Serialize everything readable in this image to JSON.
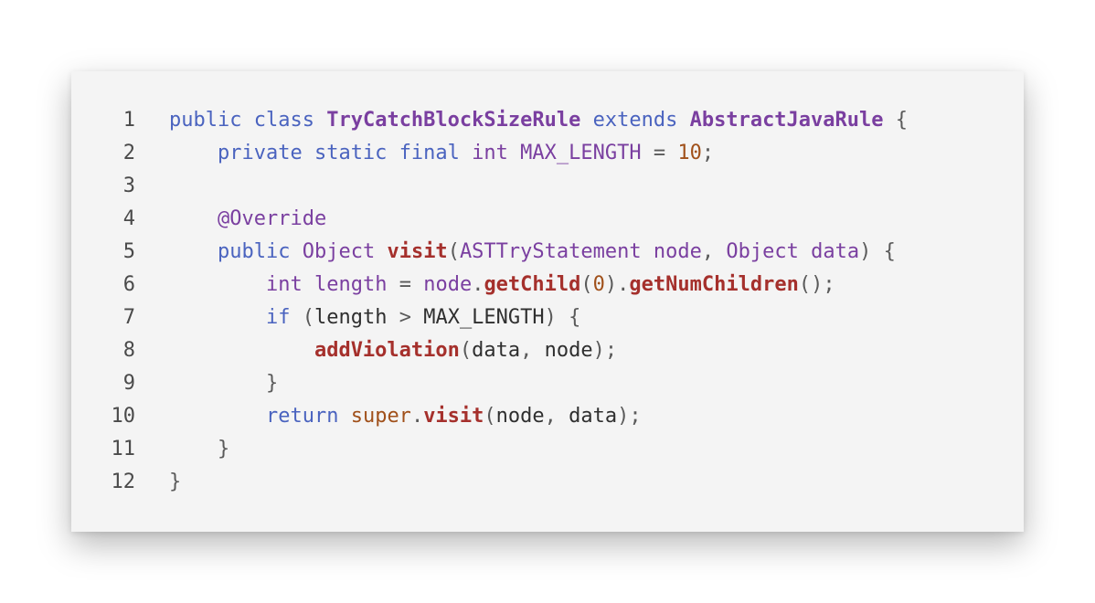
{
  "code": {
    "lines": [
      {
        "number": "1",
        "tokens": [
          {
            "text": "public",
            "kind": "keyword"
          },
          {
            "text": " ",
            "kind": "space"
          },
          {
            "text": "class",
            "kind": "keyword"
          },
          {
            "text": " ",
            "kind": "space"
          },
          {
            "text": "TryCatchBlockSizeRule",
            "kind": "class"
          },
          {
            "text": " ",
            "kind": "space"
          },
          {
            "text": "extends",
            "kind": "keyword"
          },
          {
            "text": " ",
            "kind": "space"
          },
          {
            "text": "AbstractJavaRule",
            "kind": "class"
          },
          {
            "text": " {",
            "kind": "punct"
          }
        ]
      },
      {
        "number": "2",
        "tokens": [
          {
            "text": "    ",
            "kind": "space"
          },
          {
            "text": "private",
            "kind": "keyword"
          },
          {
            "text": " ",
            "kind": "space"
          },
          {
            "text": "static",
            "kind": "keyword"
          },
          {
            "text": " ",
            "kind": "space"
          },
          {
            "text": "final",
            "kind": "keyword"
          },
          {
            "text": " ",
            "kind": "space"
          },
          {
            "text": "int",
            "kind": "type"
          },
          {
            "text": " ",
            "kind": "space"
          },
          {
            "text": "MAX_LENGTH",
            "kind": "type"
          },
          {
            "text": " = ",
            "kind": "punct"
          },
          {
            "text": "10",
            "kind": "number"
          },
          {
            "text": ";",
            "kind": "punct"
          }
        ]
      },
      {
        "number": "3",
        "tokens": []
      },
      {
        "number": "4",
        "tokens": [
          {
            "text": "    ",
            "kind": "space"
          },
          {
            "text": "@Override",
            "kind": "annotation"
          }
        ]
      },
      {
        "number": "5",
        "tokens": [
          {
            "text": "    ",
            "kind": "space"
          },
          {
            "text": "public",
            "kind": "keyword"
          },
          {
            "text": " ",
            "kind": "space"
          },
          {
            "text": "Object",
            "kind": "type"
          },
          {
            "text": " ",
            "kind": "space"
          },
          {
            "text": "visit",
            "kind": "method"
          },
          {
            "text": "(",
            "kind": "punct"
          },
          {
            "text": "ASTTryStatement",
            "kind": "type"
          },
          {
            "text": " ",
            "kind": "space"
          },
          {
            "text": "node",
            "kind": "type"
          },
          {
            "text": ", ",
            "kind": "punct"
          },
          {
            "text": "Object",
            "kind": "type"
          },
          {
            "text": " ",
            "kind": "space"
          },
          {
            "text": "data",
            "kind": "type"
          },
          {
            "text": ") {",
            "kind": "punct"
          }
        ]
      },
      {
        "number": "6",
        "tokens": [
          {
            "text": "        ",
            "kind": "space"
          },
          {
            "text": "int",
            "kind": "type"
          },
          {
            "text": " ",
            "kind": "space"
          },
          {
            "text": "length",
            "kind": "type"
          },
          {
            "text": " = ",
            "kind": "punct"
          },
          {
            "text": "node",
            "kind": "type"
          },
          {
            "text": ".",
            "kind": "punct"
          },
          {
            "text": "getChild",
            "kind": "method"
          },
          {
            "text": "(",
            "kind": "punct"
          },
          {
            "text": "0",
            "kind": "number"
          },
          {
            "text": ").",
            "kind": "punct"
          },
          {
            "text": "getNumChildren",
            "kind": "method"
          },
          {
            "text": "();",
            "kind": "punct"
          }
        ]
      },
      {
        "number": "7",
        "tokens": [
          {
            "text": "        ",
            "kind": "space"
          },
          {
            "text": "if",
            "kind": "keyword"
          },
          {
            "text": " (",
            "kind": "punct"
          },
          {
            "text": "length",
            "kind": "plain"
          },
          {
            "text": " > ",
            "kind": "punct"
          },
          {
            "text": "MAX_LENGTH",
            "kind": "plain"
          },
          {
            "text": ") {",
            "kind": "punct"
          }
        ]
      },
      {
        "number": "8",
        "tokens": [
          {
            "text": "            ",
            "kind": "space"
          },
          {
            "text": "addViolation",
            "kind": "method"
          },
          {
            "text": "(",
            "kind": "punct"
          },
          {
            "text": "data",
            "kind": "plain"
          },
          {
            "text": ", ",
            "kind": "punct"
          },
          {
            "text": "node",
            "kind": "plain"
          },
          {
            "text": ");",
            "kind": "punct"
          }
        ]
      },
      {
        "number": "9",
        "tokens": [
          {
            "text": "        ",
            "kind": "space"
          },
          {
            "text": "}",
            "kind": "punct"
          }
        ]
      },
      {
        "number": "10",
        "tokens": [
          {
            "text": "        ",
            "kind": "space"
          },
          {
            "text": "return",
            "kind": "keyword"
          },
          {
            "text": " ",
            "kind": "space"
          },
          {
            "text": "super",
            "kind": "special"
          },
          {
            "text": ".",
            "kind": "punct"
          },
          {
            "text": "visit",
            "kind": "method"
          },
          {
            "text": "(",
            "kind": "punct"
          },
          {
            "text": "node",
            "kind": "plain"
          },
          {
            "text": ", ",
            "kind": "punct"
          },
          {
            "text": "data",
            "kind": "plain"
          },
          {
            "text": ");",
            "kind": "punct"
          }
        ]
      },
      {
        "number": "11",
        "tokens": [
          {
            "text": "    ",
            "kind": "space"
          },
          {
            "text": "}",
            "kind": "punct"
          }
        ]
      },
      {
        "number": "12",
        "tokens": [
          {
            "text": "}",
            "kind": "punct"
          }
        ]
      }
    ]
  },
  "colors": {
    "card_background": "#f4f4f4",
    "keyword": "#4a63bf",
    "class_name": "#7a3fa0",
    "method": "#a5302c",
    "number": "#a0501a"
  }
}
